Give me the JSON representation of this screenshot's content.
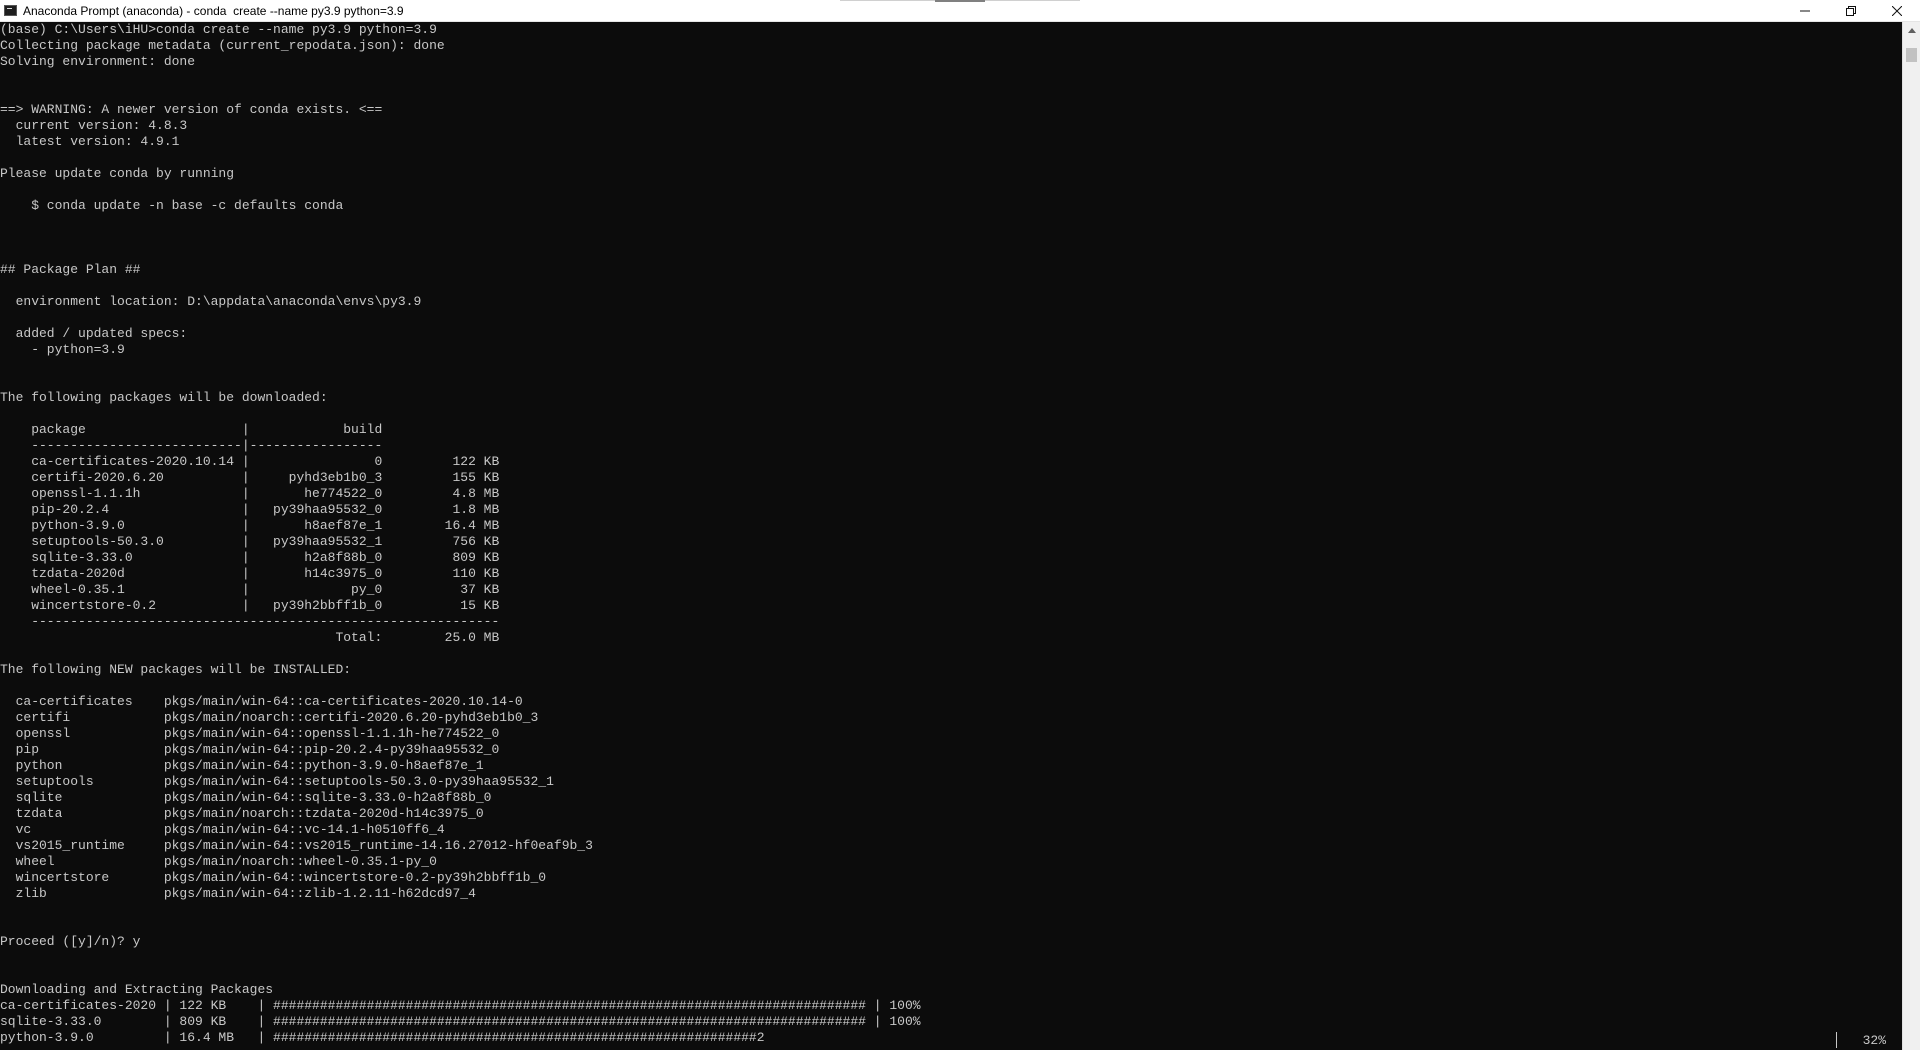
{
  "window": {
    "title": "Anaconda Prompt (anaconda) - conda  create --name py3.9 python=3.9",
    "minimize_glyph": "—",
    "restore_glyph": "❐",
    "close_glyph": "✕"
  },
  "console": {
    "lines": [
      "(base) C:\\Users\\iHU>conda create --name py3.9 python=3.9",
      "Collecting package metadata (current_repodata.json): done",
      "Solving environment: done",
      "",
      "",
      "==> WARNING: A newer version of conda exists. <==",
      "  current version: 4.8.3",
      "  latest version: 4.9.1",
      "",
      "Please update conda by running",
      "",
      "    $ conda update -n base -c defaults conda",
      "",
      "",
      "",
      "## Package Plan ##",
      "",
      "  environment location: D:\\appdata\\anaconda\\envs\\py3.9",
      "",
      "  added / updated specs:",
      "    - python=3.9",
      "",
      "",
      "The following packages will be downloaded:",
      "",
      "    package                    |            build",
      "    ---------------------------|-----------------",
      "    ca-certificates-2020.10.14 |                0         122 KB",
      "    certifi-2020.6.20          |     pyhd3eb1b0_3         155 KB",
      "    openssl-1.1.1h             |       he774522_0         4.8 MB",
      "    pip-20.2.4                 |   py39haa95532_0         1.8 MB",
      "    python-3.9.0               |       h8aef87e_1        16.4 MB",
      "    setuptools-50.3.0          |   py39haa95532_1         756 KB",
      "    sqlite-3.33.0              |       h2a8f88b_0         809 KB",
      "    tzdata-2020d               |       h14c3975_0         110 KB",
      "    wheel-0.35.1               |             py_0          37 KB",
      "    wincertstore-0.2           |   py39h2bbff1b_0          15 KB",
      "    ------------------------------------------------------------",
      "                                           Total:        25.0 MB",
      "",
      "The following NEW packages will be INSTALLED:",
      "",
      "  ca-certificates    pkgs/main/win-64::ca-certificates-2020.10.14-0",
      "  certifi            pkgs/main/noarch::certifi-2020.6.20-pyhd3eb1b0_3",
      "  openssl            pkgs/main/win-64::openssl-1.1.1h-he774522_0",
      "  pip                pkgs/main/win-64::pip-20.2.4-py39haa95532_0",
      "  python             pkgs/main/win-64::python-3.9.0-h8aef87e_1",
      "  setuptools         pkgs/main/win-64::setuptools-50.3.0-py39haa95532_1",
      "  sqlite             pkgs/main/win-64::sqlite-3.33.0-h2a8f88b_0",
      "  tzdata             pkgs/main/noarch::tzdata-2020d-h14c3975_0",
      "  vc                 pkgs/main/win-64::vc-14.1-h0510ff6_4",
      "  vs2015_runtime     pkgs/main/win-64::vs2015_runtime-14.16.27012-hf0eaf9b_3",
      "  wheel              pkgs/main/noarch::wheel-0.35.1-py_0",
      "  wincertstore       pkgs/main/win-64::wincertstore-0.2-py39h2bbff1b_0",
      "  zlib               pkgs/main/win-64::zlib-1.2.11-h62dcd97_4",
      "",
      "",
      "Proceed ([y]/n)? y",
      "",
      "",
      "Downloading and Extracting Packages",
      "ca-certificates-2020 | 122 KB    | ############################################################################ | 100%",
      "sqlite-3.33.0        | 809 KB    | ############################################################################ | 100%",
      "python-3.9.0         | 16.4 MB   | ##############################################################2"
    ],
    "current_progress_percent": "32%"
  }
}
